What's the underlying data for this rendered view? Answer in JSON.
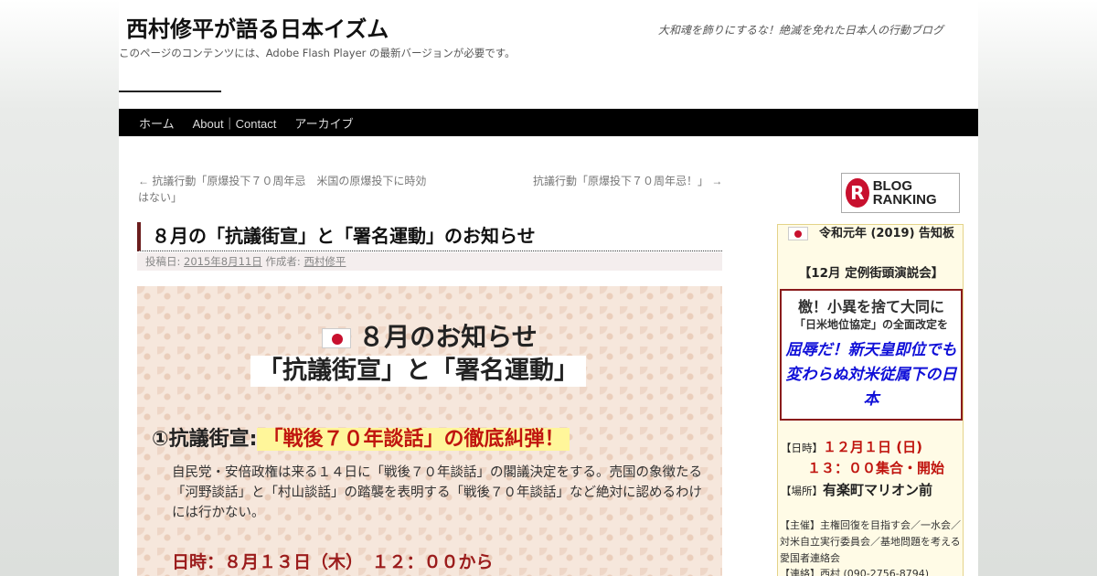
{
  "site": {
    "title": "西村修平が語る日本イズム",
    "description": "大和魂を飾りにするな！絶滅を免れた日本人の行動ブログ",
    "flash_notice": "このページのコンテンツには、Adobe Flash Player の最新バージョンが必要です。"
  },
  "nav": {
    "items": [
      "ホーム",
      "About｜Contact",
      "アーカイブ"
    ]
  },
  "post_nav": {
    "prev": "← 抗議行動「原爆投下７０周年忌　米国の原爆投下に時効はない」",
    "next": "抗議行動「原爆投下７０周年忌！」 →"
  },
  "post": {
    "title": "８月の「抗議街宣」と「署名運動」のお知らせ",
    "meta_posted": "投稿日: ",
    "date": "2015年8月11日",
    "meta_author": " 作成者: ",
    "author": "西村修平"
  },
  "poster": {
    "heading": "８月のお知らせ",
    "subheading": "「抗議街宣」と「署名運動」",
    "point1_label": "①抗議街宣:",
    "point1_highlight": "「戦後７０年談話」の徹底糾弾！",
    "point1_body": "自民党・安倍政権は来る１４日に「戦後７０年談話」の閣議決定をする。売国の象徴たる「河野談話」と「村山談話」の踏襲を表明する「戦後７０年談話」など絶対に認めるわけには行かない。",
    "point1_date": "日時：８月１３日（木）　１２：００から"
  },
  "sidebar": {
    "ranking_badge": "BLOG RANKING",
    "box_title": "令和元年 (2019) 告知板",
    "event_title": "【12月 定例街頭演説会】",
    "callout_big": "檄！小異を捨て大同に",
    "callout_small": "「日米地位協定」の全面改定を",
    "callout_blue": "屈辱だ！新天皇即位でも変わらぬ対米従属下の日本",
    "date_label": "【日時】",
    "date_value": "１２月１日 (日)",
    "time_value": "１３：００集合・開始",
    "place_label": "【場所】",
    "place_value": "有楽町マリオン前",
    "organizers": "【主催】主権回復を目指す会／一水会／対米自立実行委員会／基地問題を考える愛国者連絡会",
    "contact": "【連絡】西村 (090-2756-8794)"
  }
}
